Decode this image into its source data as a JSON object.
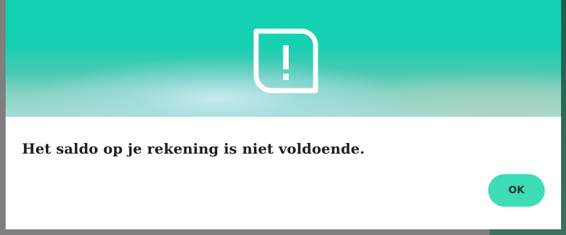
{
  "dialog": {
    "icon": "alert-exclamation-icon",
    "message": "Het saldo op je rekening is niet voldoende.",
    "ok_label": "OK"
  },
  "colors": {
    "hero_top": "#12d2b2",
    "hero_bottom": "#a6dcd4",
    "button_bg": "#3fdcb8",
    "button_text": "#173a33",
    "message_text": "#1f1f1f",
    "backdrop": "#7f7f7f"
  }
}
